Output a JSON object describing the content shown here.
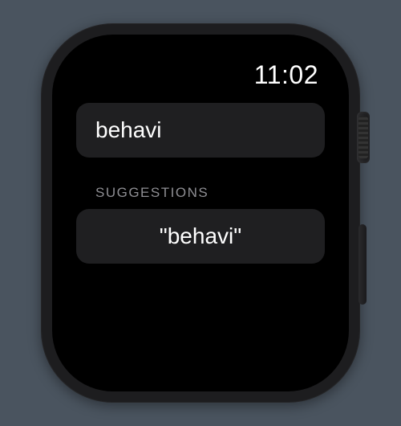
{
  "statusbar": {
    "time": "11:02"
  },
  "input": {
    "value": "behavi"
  },
  "suggestions": {
    "label": "SUGGESTIONS",
    "items": [
      {
        "display": "\"behavi\""
      }
    ]
  }
}
